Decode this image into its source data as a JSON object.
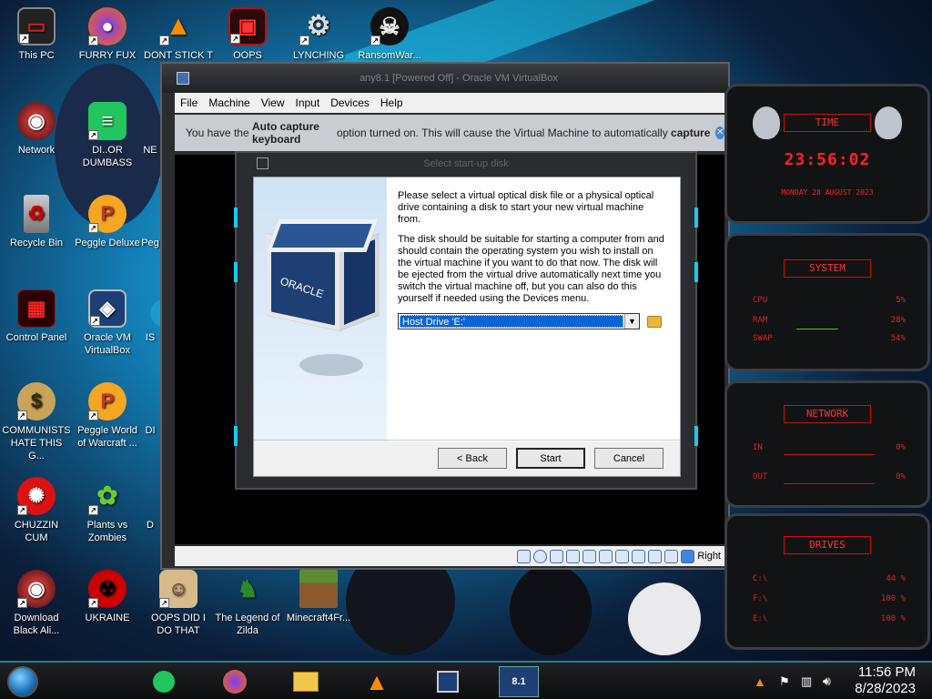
{
  "desktop": {
    "icons": [
      {
        "label": "This PC",
        "glyph": "monitor-icon"
      },
      {
        "label": "FURRY FUX",
        "glyph": "firefox-icon"
      },
      {
        "label": "DONT STICK T",
        "glyph": "vlc-icon"
      },
      {
        "label": "OOPS",
        "glyph": "red-app-icon"
      },
      {
        "label": "LYNCHING",
        "glyph": "gear-icon"
      },
      {
        "label": "RansomWar...",
        "glyph": "skull-icon"
      },
      {
        "label": "Network",
        "glyph": "network-icon"
      },
      {
        "label": "DI..OR DUMBASS",
        "glyph": "discord-icon"
      },
      {
        "label": "NE",
        "glyph": "partial-icon"
      },
      {
        "label": "Recycle Bin",
        "glyph": "recycle-bin-icon"
      },
      {
        "label": "Peggle Deluxe",
        "glyph": "peggle-icon"
      },
      {
        "label": "Peg",
        "glyph": "partial-icon"
      },
      {
        "label": "Control Panel",
        "glyph": "control-panel-icon"
      },
      {
        "label": "Oracle VM VirtualBox",
        "glyph": "virtualbox-icon"
      },
      {
        "label": "IS",
        "glyph": "partial-icon"
      },
      {
        "label": "COMMUNISTS HATE THIS G...",
        "glyph": "money-bag-icon"
      },
      {
        "label": "Peggle World of Warcraft ...",
        "glyph": "peggle-icon"
      },
      {
        "label": "DI",
        "glyph": "partial-icon"
      },
      {
        "label": "CHUZZIN CUM",
        "glyph": "chuzzle-icon"
      },
      {
        "label": "Plants vs Zombies",
        "glyph": "plant-icon"
      },
      {
        "label": "D",
        "glyph": "partial-icon"
      },
      {
        "label": "Download Black Ali...",
        "glyph": "alien-icon"
      },
      {
        "label": "UKRAINE",
        "glyph": "radiation-icon"
      },
      {
        "label": "OOPS DID I DO THAT",
        "glyph": "portrait-icon"
      },
      {
        "label": "The Legend of Zilda",
        "glyph": "link-sprite-icon"
      },
      {
        "label": "Minecraft4Fr...",
        "glyph": "minecraft-icon"
      }
    ]
  },
  "vm_window": {
    "title": "any8.1 [Powered Off] - Oracle VM VirtualBox",
    "menu": [
      "File",
      "Machine",
      "View",
      "Input",
      "Devices",
      "Help"
    ],
    "notice_prefix": "You have the ",
    "notice_bold1": "Auto capture keyboard",
    "notice_mid": " option turned on. This will cause the Virtual Machine to automatically ",
    "notice_bold2": "capture",
    "status_host_key": "Right"
  },
  "dialog": {
    "title": "Select start-up disk",
    "para1": "Please select a virtual optical disk file or a physical optical drive containing a disk to start your new virtual machine from.",
    "para2": "The disk should be suitable for starting a computer from and should contain the operating system you wish to install on the virtual machine if you want to do that now. The disk will be ejected from the virtual drive automatically next time you switch the virtual machine off, but you can also do this yourself if needed using the Devices menu.",
    "selected_disk": "Host Drive 'E:'",
    "back_label": "< Back",
    "start_label": "Start",
    "cancel_label": "Cancel",
    "art_text": "ORACLE"
  },
  "widgets": {
    "time": {
      "title": "TIME",
      "clock": "23:56:02",
      "date": "MONDAY 28 AUGUST 2023"
    },
    "system": {
      "title": "SYSTEM",
      "rows": [
        {
          "name": "CPU",
          "value": "5%"
        },
        {
          "name": "RAM",
          "value": "28%"
        },
        {
          "name": "SWAP",
          "value": "54%"
        }
      ]
    },
    "network": {
      "title": "NETWORK",
      "rows": [
        {
          "name": "IN",
          "value": "0%"
        },
        {
          "name": "OUT",
          "value": "0%"
        }
      ]
    },
    "drives": {
      "title": "DRIVES",
      "rows": [
        {
          "name": "C:\\",
          "value": "44 %"
        },
        {
          "name": "F:\\",
          "value": "100 %"
        },
        {
          "name": "E:\\",
          "value": "100 %"
        }
      ]
    }
  },
  "taskbar": {
    "apps": [
      "discord-icon",
      "firefox-icon",
      "file-explorer-icon",
      "vlc-icon",
      "virtualbox-icon",
      "vm-8.1-icon"
    ],
    "vm_badge": "8.1",
    "time": "11:56 PM",
    "date": "8/28/2023"
  }
}
